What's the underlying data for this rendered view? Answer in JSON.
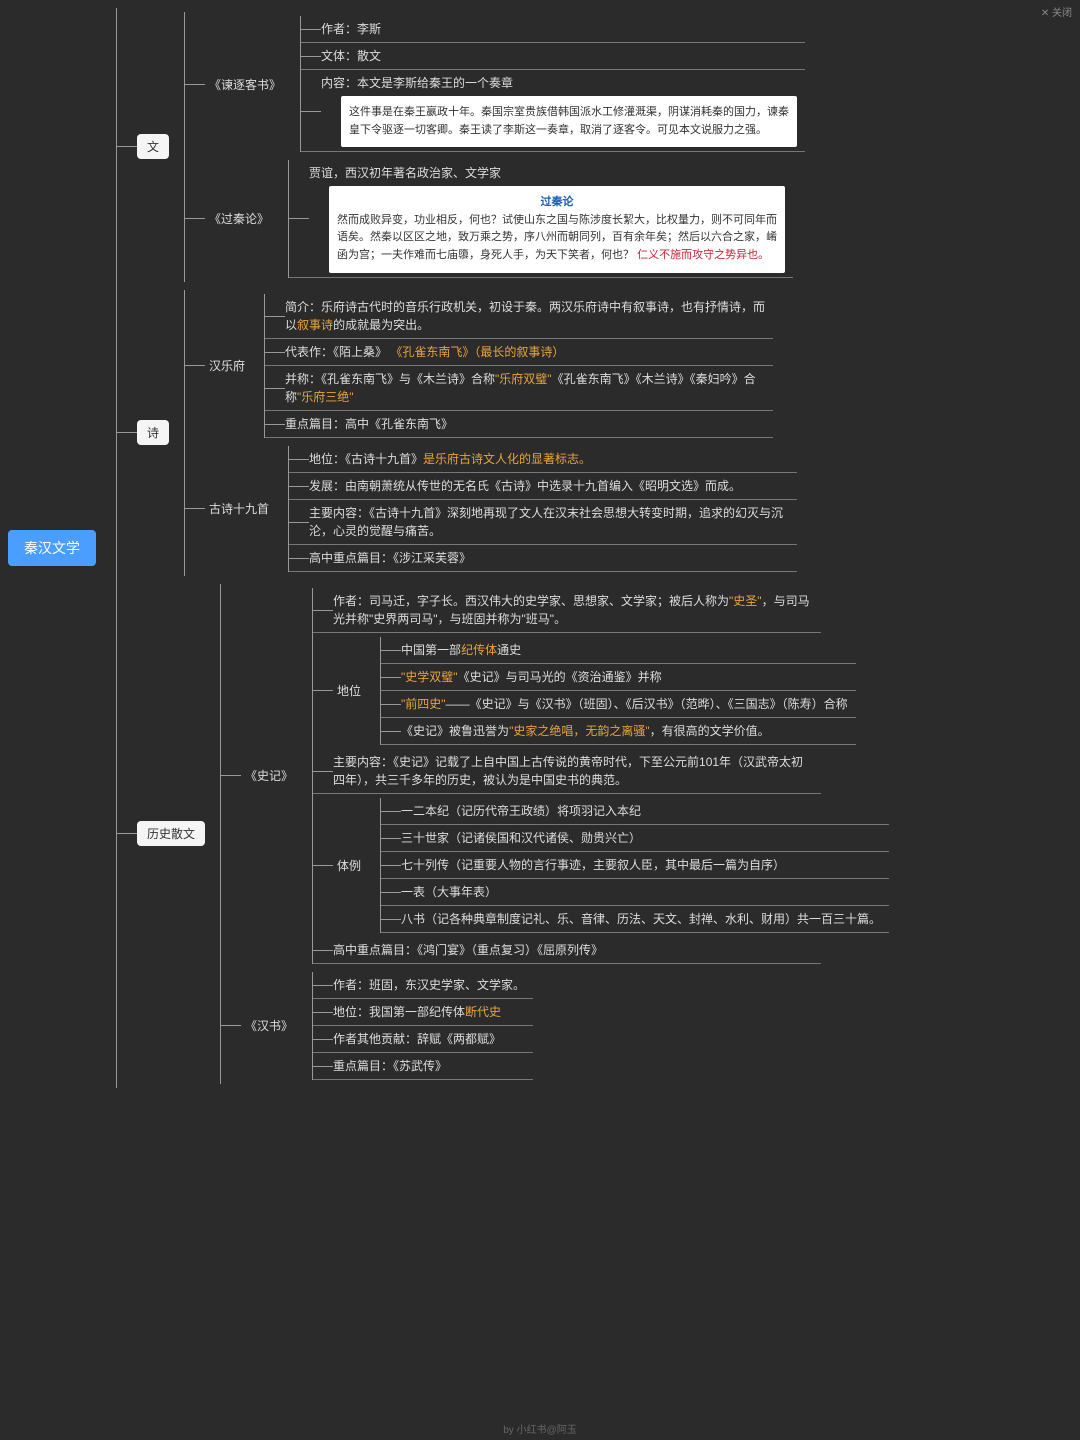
{
  "topBtn": "✕ 关闭",
  "footer": "by 小红书@阿玉",
  "root": "秦汉文学",
  "wen": {
    "label": "文",
    "jian": {
      "label": "《谏逐客书》",
      "author": "作者：李斯",
      "style": "文体：散文",
      "content": "内容：本文是李斯给秦王的一个奏章",
      "note": "这件事是在秦王嬴政十年。秦国宗室贵族借韩国派水工修灌溉渠，阴谋消耗秦的国力，谏秦皇下令驱逐一切客卿。秦王读了李斯这一奏章，取消了逐客令。可见本文说服力之强。"
    },
    "guo": {
      "label": "《过秦论》",
      "intro": "贾谊，西汉初年著名政治家、文学家",
      "noteTitle": "过秦论",
      "noteBody": "然而成败异变，功业相反，何也？试使山东之国与陈涉度长絜大，比权量力，则不可同年而语矣。然秦以区区之地，致万乘之势，序八州而朝同列，百有余年矣；然后以六合之家，崤函为宫；一夫作难而七庙隳，身死人手，为天下笑者，何也？",
      "noteRed": "仁义不施而攻守之势异也。"
    }
  },
  "shi": {
    "label": "诗",
    "yuefu": {
      "label": "汉乐府",
      "intro1": "简介：乐府诗古代时的音乐行政机关，初设于秦。两汉乐府诗中有叙事诗，也有抒情诗，而以",
      "intro1hl": "叙事诗",
      "intro1b": "的成就最为突出。",
      "rep1": "代表作：《陌上桑》",
      "rep1hl": "《孔雀东南飞》（最长的叙事诗）",
      "bing1": "并称：《孔雀东南飞》与《木兰诗》合称",
      "bing1hl": "\"乐府双璧\"",
      "bing1b": "《孔雀东南飞》《木兰诗》《秦妇吟》合称",
      "bing1hl2": "\"乐府三绝\"",
      "zd": "重点篇目：高中《孔雀东南飞》"
    },
    "gushi": {
      "label": "古诗十九首",
      "pos1": "地位：《古诗十九首》",
      "pos1hl": "是乐府古诗文人化的显著标志。",
      "fazhan": "发展：由南朝萧统从传世的无名氏《古诗》中选录十九首编入《昭明文选》而成。",
      "cont": "主要内容：《古诗十九首》深刻地再现了文人在汉末社会思想大转变时期，追求的幻灭与沉沦，心灵的觉醒与痛苦。",
      "zd": "高中重点篇目：《涉江采芙蓉》"
    }
  },
  "sanwen": {
    "label": "历史散文",
    "shiji": {
      "label": "《史记》",
      "author1": "作者：司马迁，字子长。西汉伟大的史学家、思想家、文学家；被后人称为",
      "author1hl": "\"史圣\"",
      "author1b": "，与司马光并称\"史界两司马\"，与班固并称为\"班马\"。",
      "diwei": {
        "label": "地位",
        "a": "中国第一部",
        "ahl": "纪传体",
        "ab": "通史",
        "b": "\"史学双璧\"",
        "bb": "《史记》与司马光的《资治通鉴》并称",
        "c": "\"前四史\"",
        "cb": "——《史记》与《汉书》（班固）、《后汉书》（范晔）、《三国志》（陈寿）合称",
        "d": "《史记》被鲁迅誉为",
        "dhl": "\"史家之绝唱，无韵之离骚\"",
        "db": "，有很高的文学价值。"
      },
      "zhuyao": "主要内容：《史记》记载了上自中国上古传说的黄帝时代，下至公元前101年（汉武帝太初四年），共三千多年的历史，被认为是中国史书的典范。",
      "tili": {
        "label": "体例",
        "a": "一二本纪（记历代帝王政绩）将项羽记入本纪",
        "b": "三十世家（记诸侯国和汉代诸侯、勋贵兴亡）",
        "c": "七十列传（记重要人物的言行事迹，主要叙人臣，其中最后一篇为自序）",
        "d": "一表（大事年表）",
        "e": "八书（记各种典章制度记礼、乐、音律、历法、天文、封禅、水利、财用）共一百三十篇。"
      },
      "zd": "高中重点篇目：《鸿门宴》（重点复习）《屈原列传》"
    },
    "hanshu": {
      "label": "《汉书》",
      "a": "作者：班固，东汉史学家、文学家。",
      "b1": "地位：我国第一部纪传体",
      "b1hl": "断代史",
      "c": "作者其他贡献：辞赋《两都赋》",
      "d": "重点篇目：《苏武传》"
    }
  }
}
